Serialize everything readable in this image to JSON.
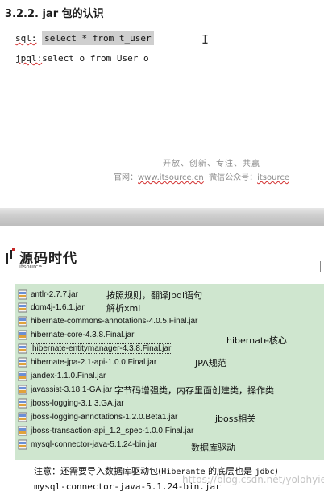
{
  "heading": "3.2.2. jar 包的认识",
  "code": {
    "line1_prefix": "sql:",
    "line1_selected": "select * from t_user",
    "line2_prefix": "jpql:",
    "line2_rest": "select o from User o"
  },
  "cursor": "I",
  "footer": {
    "slogan": "开放、创新、专注、共赢",
    "site_label": "官网：",
    "site_url": "www.itsource.cn",
    "wechat_label": "微信公众号：",
    "wechat_id": "itsource"
  },
  "logo": {
    "name": "源码时代",
    "sub": "itsource."
  },
  "files": [
    "antlr-2.7.7.jar",
    "dom4j-1.6.1.jar",
    "hibernate-commons-annotations-4.0.5.Final.jar",
    "hibernate-core-4.3.8.Final.jar",
    "hibernate-entitymanager-4.3.8.Final.jar",
    "hibernate-jpa-2.1-api-1.0.0.Final.jar",
    "jandex-1.1.0.Final.jar",
    "javassist-3.18.1-GA.jar",
    "jboss-logging-3.1.3.GA.jar",
    "jboss-logging-annotations-1.2.0.Beta1.jar",
    "jboss-transaction-api_1.2_spec-1.0.0.Final.jar",
    "mysql-connector-java-5.1.24-bin.jar"
  ],
  "notes": {
    "antlr": "按照规则，翻译jpql语句",
    "dom4j": "解析xml",
    "hibernate": "hibernate核心",
    "jpa": "JPA规范",
    "javassist": "字节码增强类，内存里面创建类，操作类",
    "jboss": "jboss相关",
    "mysql": "数据库驱动"
  },
  "bottom_note": {
    "prefix": "注意：还需要导入数据库驱动包(",
    "hib": "Hiberante",
    "mid": " 的底层也是 ",
    "jdbc": "jdbc",
    "suffix": ")"
  },
  "bottom_code": "mysql-connector-java-5.1.24-bin.jar",
  "watermark": "https://blog.csdn.net/yolohyiee",
  "colors": {
    "panel_bg": "#cfe6cf",
    "selection_bg": "#cfcfcf",
    "squiggle": "#d32f2f"
  }
}
